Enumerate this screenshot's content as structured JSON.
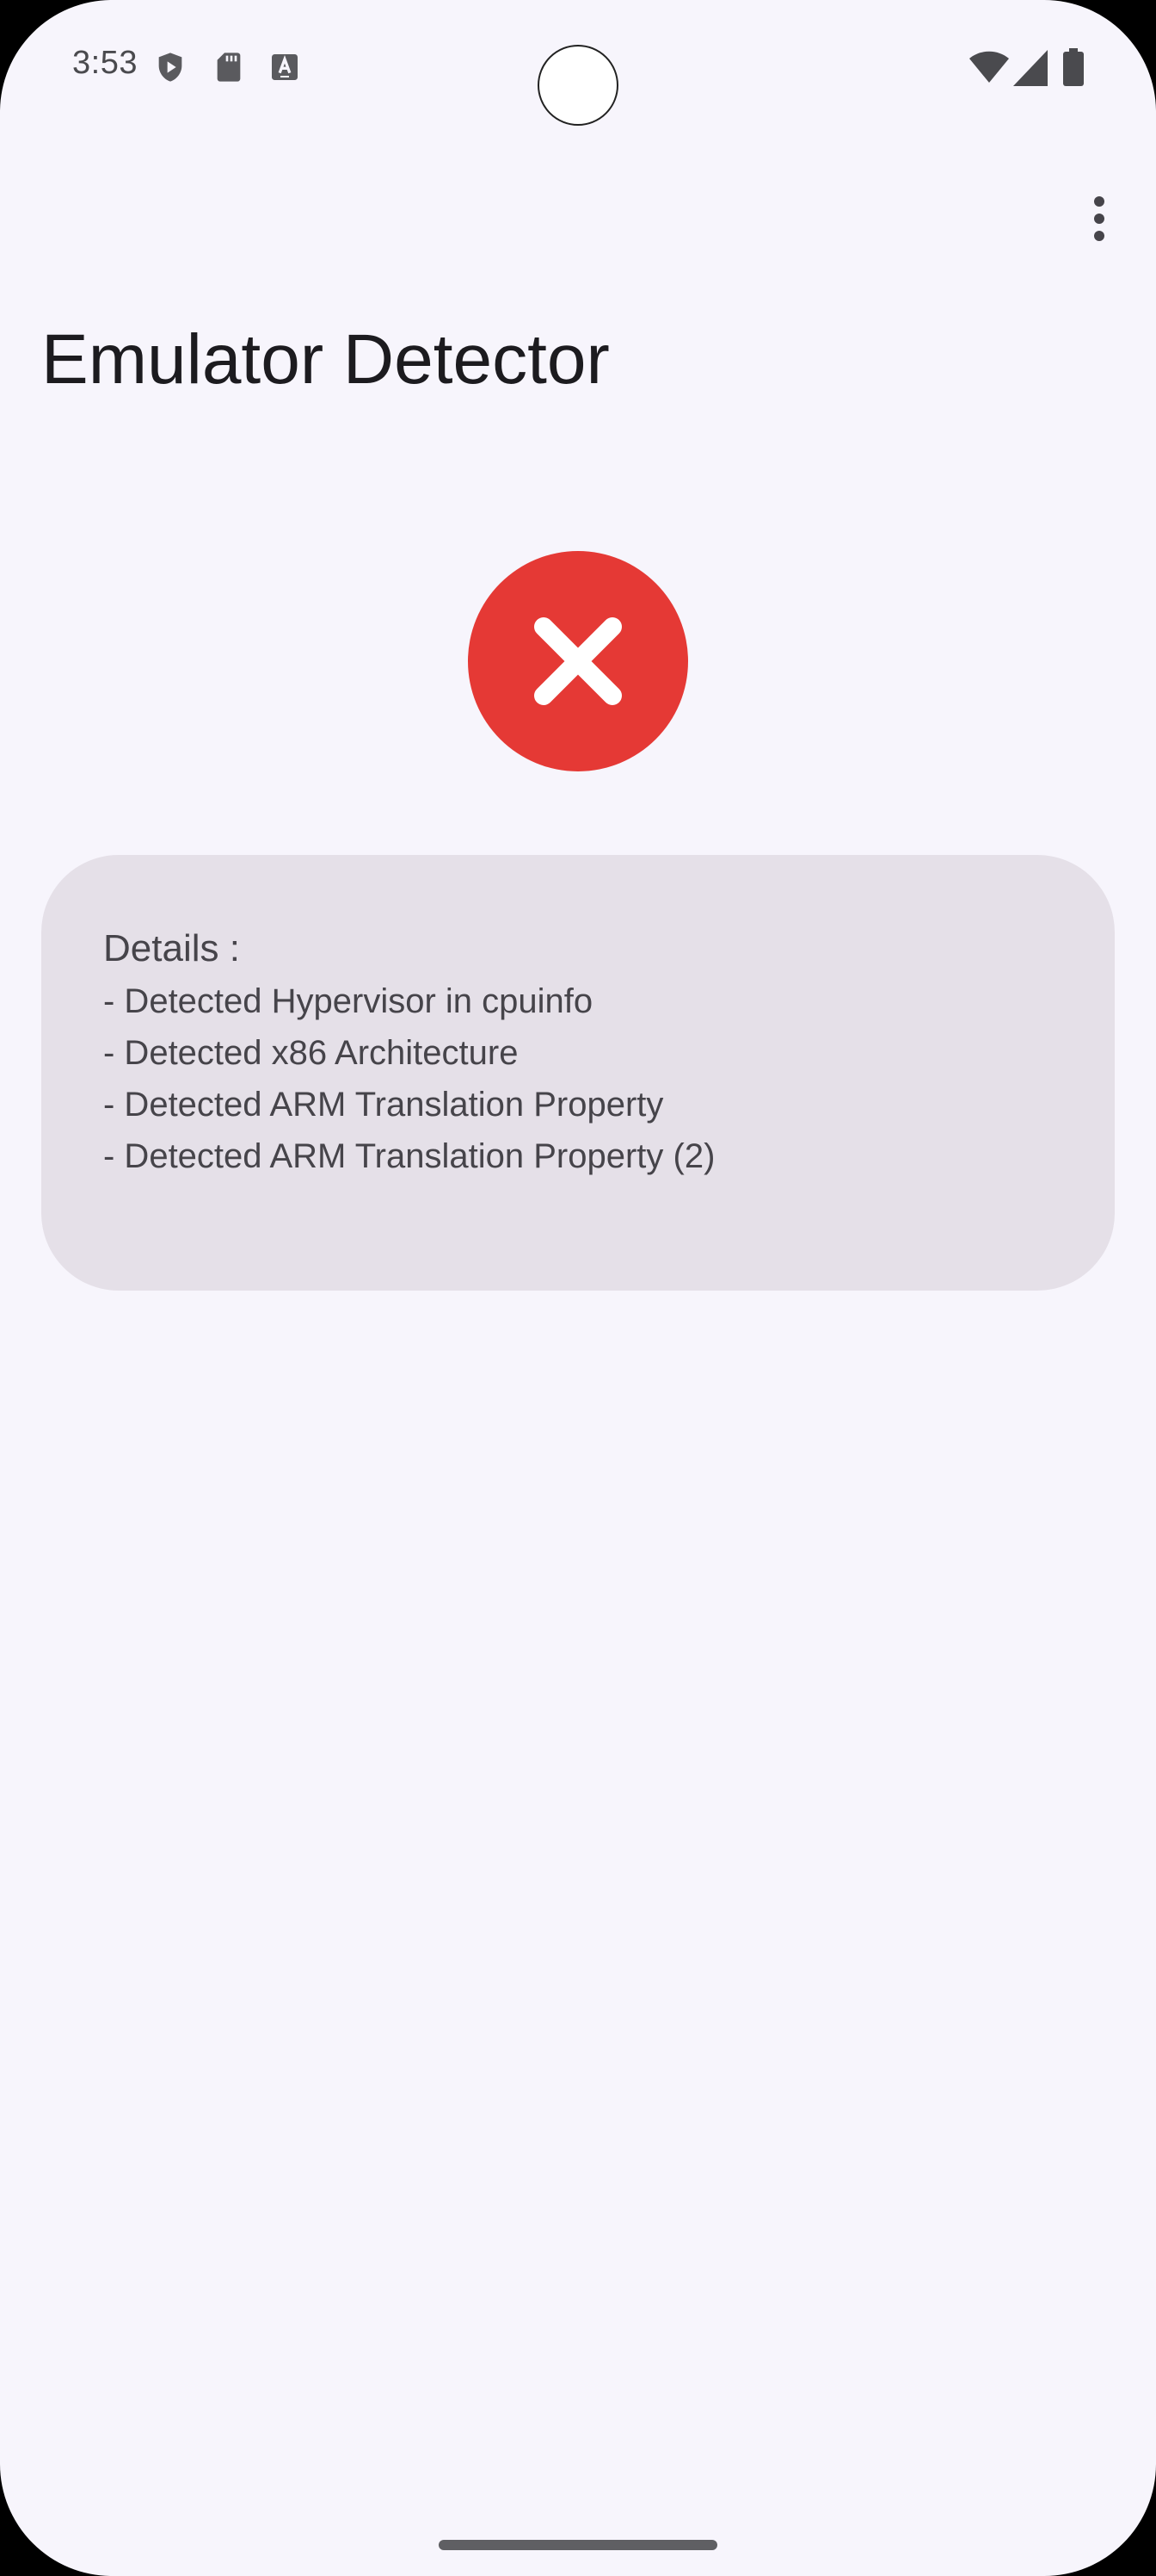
{
  "status_bar": {
    "time": "3:53",
    "left_icons": [
      "play-protect-icon",
      "sd-card-icon",
      "keyboard-a-icon"
    ],
    "right_icons": [
      "wifi-icon",
      "cell-signal-icon",
      "battery-icon"
    ]
  },
  "app_bar": {
    "title": "Emulator Detector",
    "menu_icon": "more-vert-icon"
  },
  "result": {
    "icon": "close-icon",
    "color": "#e53935",
    "icon_color": "#ffffff"
  },
  "details": {
    "heading": "Details :",
    "lines": [
      "- Detected Hypervisor in cpuinfo",
      "- Detected x86 Architecture",
      "- Detected ARM Translation Property",
      "- Detected ARM Translation Property (2)"
    ]
  },
  "colors": {
    "background": "#f7f5fc",
    "card": "#e5e0e8",
    "text_primary": "#1c1b1f",
    "text_secondary": "#46444a"
  }
}
